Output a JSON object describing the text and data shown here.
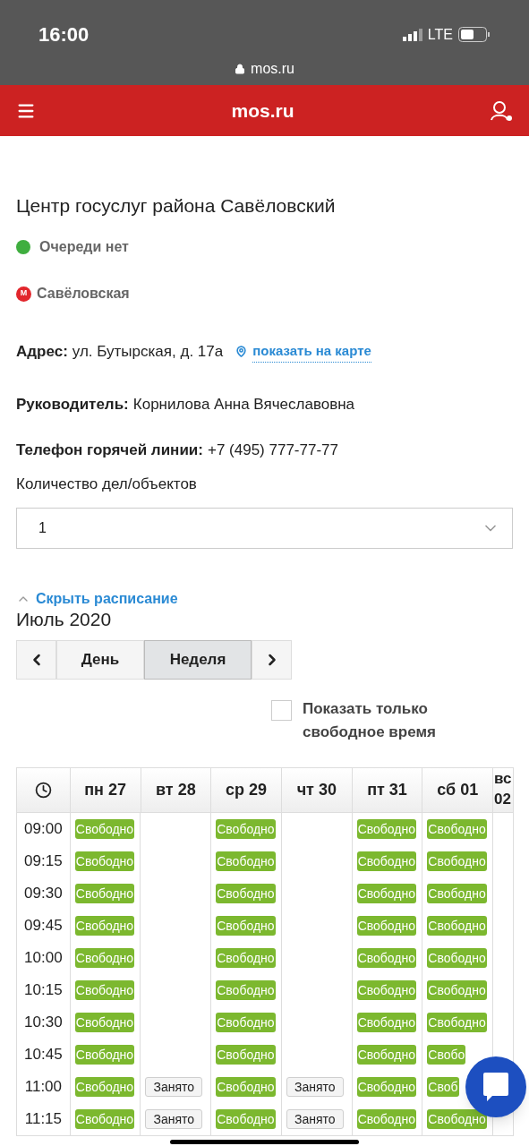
{
  "status_bar": {
    "time": "16:00",
    "network": "LTE"
  },
  "browser": {
    "url": "mos.ru"
  },
  "header": {
    "logo": "mos.ru"
  },
  "office": {
    "title": "Центр госуслуг района Савёловский",
    "queue": {
      "text": "Очереди нет",
      "color": "#3fae3f"
    },
    "metro": {
      "badge": "М",
      "station": "Савёловская"
    },
    "address": {
      "label": "Адрес:",
      "value": "ул. Бутырская, д. 17а",
      "map_link": "показать на карте"
    },
    "manager": {
      "label": "Руководитель:",
      "value": "Корнилова Анна Вячеславовна"
    },
    "phone": {
      "label": "Телефон горячей линии:",
      "value": "+7 (495) 777-77-77"
    }
  },
  "count": {
    "label": "Количество дел/объектов",
    "value": "1"
  },
  "schedule": {
    "toggle": "Скрыть расписание",
    "month": "Июль 2020",
    "views": [
      {
        "label": "День",
        "selected": false
      },
      {
        "label": "Неделя",
        "selected": true
      }
    ],
    "free_only": {
      "label": "Показать только свободное время",
      "checked": false
    },
    "days": [
      "пн 27",
      "вт 28",
      "ср 29",
      "чт 30",
      "пт 31",
      "сб 01",
      "вс 02"
    ],
    "rows": [
      {
        "time": "09:00",
        "cells": [
          {
            "kind": "free",
            "label": "Свободно"
          },
          {
            "kind": "empty"
          },
          {
            "kind": "free",
            "label": "Свободно"
          },
          {
            "kind": "empty"
          },
          {
            "kind": "free",
            "label": "Свободно"
          },
          {
            "kind": "free",
            "label": "Свободно"
          },
          {
            "kind": "empty"
          }
        ]
      },
      {
        "time": "09:15",
        "cells": [
          {
            "kind": "free",
            "label": "Свободно"
          },
          {
            "kind": "empty"
          },
          {
            "kind": "free",
            "label": "Свободно"
          },
          {
            "kind": "empty"
          },
          {
            "kind": "free",
            "label": "Свободно"
          },
          {
            "kind": "free",
            "label": "Свободно"
          },
          {
            "kind": "empty"
          }
        ]
      },
      {
        "time": "09:30",
        "cells": [
          {
            "kind": "free",
            "label": "Свободно"
          },
          {
            "kind": "empty"
          },
          {
            "kind": "free",
            "label": "Свободно"
          },
          {
            "kind": "empty"
          },
          {
            "kind": "free",
            "label": "Свободно"
          },
          {
            "kind": "free",
            "label": "Свободно"
          },
          {
            "kind": "empty"
          }
        ]
      },
      {
        "time": "09:45",
        "cells": [
          {
            "kind": "free",
            "label": "Свободно"
          },
          {
            "kind": "empty"
          },
          {
            "kind": "free",
            "label": "Свободно"
          },
          {
            "kind": "empty"
          },
          {
            "kind": "free",
            "label": "Свободно"
          },
          {
            "kind": "free",
            "label": "Свободно"
          },
          {
            "kind": "empty"
          }
        ]
      },
      {
        "time": "10:00",
        "cells": [
          {
            "kind": "free",
            "label": "Свободно"
          },
          {
            "kind": "empty"
          },
          {
            "kind": "free",
            "label": "Свободно"
          },
          {
            "kind": "empty"
          },
          {
            "kind": "free",
            "label": "Свободно"
          },
          {
            "kind": "free",
            "label": "Свободно"
          },
          {
            "kind": "empty"
          }
        ]
      },
      {
        "time": "10:15",
        "cells": [
          {
            "kind": "free",
            "label": "Свободно"
          },
          {
            "kind": "empty"
          },
          {
            "kind": "free",
            "label": "Свободно"
          },
          {
            "kind": "empty"
          },
          {
            "kind": "free",
            "label": "Свободно"
          },
          {
            "kind": "free",
            "label": "Свободно"
          },
          {
            "kind": "empty"
          }
        ]
      },
      {
        "time": "10:30",
        "cells": [
          {
            "kind": "free",
            "label": "Свободно"
          },
          {
            "kind": "empty"
          },
          {
            "kind": "free",
            "label": "Свободно"
          },
          {
            "kind": "empty"
          },
          {
            "kind": "free",
            "label": "Свободно"
          },
          {
            "kind": "free",
            "label": "Свободно"
          },
          {
            "kind": "empty"
          }
        ]
      },
      {
        "time": "10:45",
        "cells": [
          {
            "kind": "free",
            "label": "Свободно"
          },
          {
            "kind": "empty"
          },
          {
            "kind": "free",
            "label": "Свободно"
          },
          {
            "kind": "empty"
          },
          {
            "kind": "free",
            "label": "Свободно"
          },
          {
            "kind": "free",
            "label": "Свобо"
          },
          {
            "kind": "empty"
          }
        ]
      },
      {
        "time": "11:00",
        "cells": [
          {
            "kind": "free",
            "label": "Свободно"
          },
          {
            "kind": "busy",
            "label": "Занято"
          },
          {
            "kind": "free",
            "label": "Свободно"
          },
          {
            "kind": "busy",
            "label": "Занято"
          },
          {
            "kind": "free",
            "label": "Свободно"
          },
          {
            "kind": "free",
            "label": "Своб"
          },
          {
            "kind": "empty"
          }
        ]
      },
      {
        "time": "11:15",
        "cells": [
          {
            "kind": "free",
            "label": "Свободно"
          },
          {
            "kind": "busy",
            "label": "Занято"
          },
          {
            "kind": "free",
            "label": "Свободно"
          },
          {
            "kind": "busy",
            "label": "Занято"
          },
          {
            "kind": "free",
            "label": "Свободно"
          },
          {
            "kind": "free",
            "label": "Свободно"
          },
          {
            "kind": "empty"
          }
        ]
      }
    ]
  }
}
